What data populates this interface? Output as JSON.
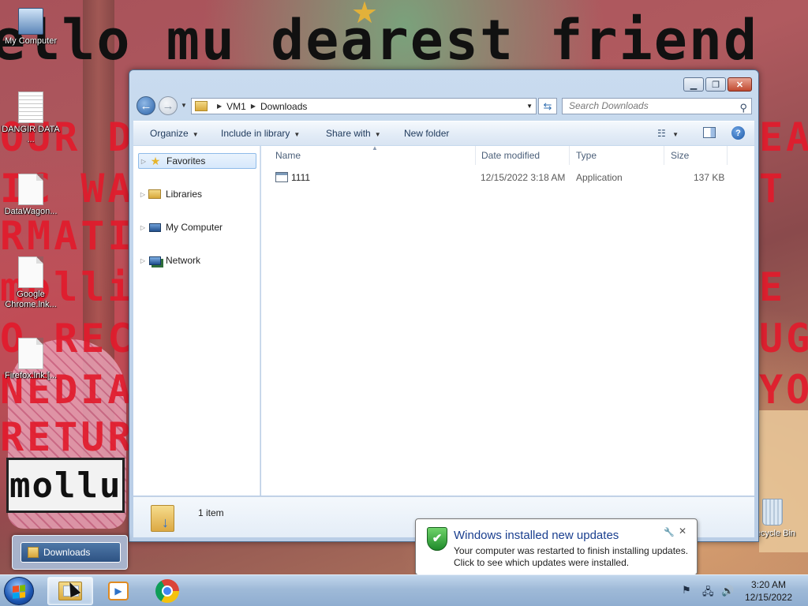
{
  "desktop": {
    "wallpaper_lines": [
      "ello mu dearest friend",
      "OUR D",
      "IC WAY",
      "RMATIO",
      "molli",
      "O REC",
      "NEDIA",
      "RETUR",
      "mollu",
      "EA",
      "T",
      "E",
      "UG",
      "YO"
    ],
    "icons": [
      {
        "label": "My Computer",
        "icon": "computer-icon"
      },
      {
        "label": "DANGIR DATA ...",
        "icon": "text-document-icon"
      },
      {
        "label": "DataWagon...",
        "icon": "document-icon"
      },
      {
        "label": "Google Chrome.lnk...",
        "icon": "document-icon"
      },
      {
        "label": "Firefox.lnk.[...",
        "icon": "document-icon"
      },
      {
        "label": "Recycle Bin",
        "icon": "recycle-bin-icon"
      }
    ]
  },
  "explorer": {
    "breadcrumb": [
      "VM1",
      "Downloads"
    ],
    "search_placeholder": "Search Downloads",
    "toolbar": {
      "organize": "Organize",
      "include_in_library": "Include in library",
      "share_with": "Share with",
      "new_folder": "New folder"
    },
    "nav": [
      {
        "label": "Favorites",
        "icon": "star-icon",
        "selected": true
      },
      {
        "label": "Libraries",
        "icon": "libraries-icon",
        "selected": false
      },
      {
        "label": "My Computer",
        "icon": "computer-icon",
        "selected": false
      },
      {
        "label": "Network",
        "icon": "network-icon",
        "selected": false
      }
    ],
    "columns": [
      "Name",
      "Date modified",
      "Type",
      "Size"
    ],
    "files": [
      {
        "name": "1111",
        "date_modified": "12/15/2022 3:18 AM",
        "type": "Application",
        "size": "137 KB"
      }
    ],
    "status": "1 item"
  },
  "notification": {
    "title": "Windows installed new updates",
    "line1": "Your computer was restarted to finish installing updates.",
    "line2": "Click to see which updates were installed."
  },
  "taskbar": {
    "thumbnail_label": "Downloads",
    "clock_time": "3:20 AM",
    "clock_date": "12/15/2022"
  },
  "colors": {
    "accent": "#1a3f8f",
    "taskbar": "#9fbad8",
    "window_frame": "#b9cde6"
  }
}
